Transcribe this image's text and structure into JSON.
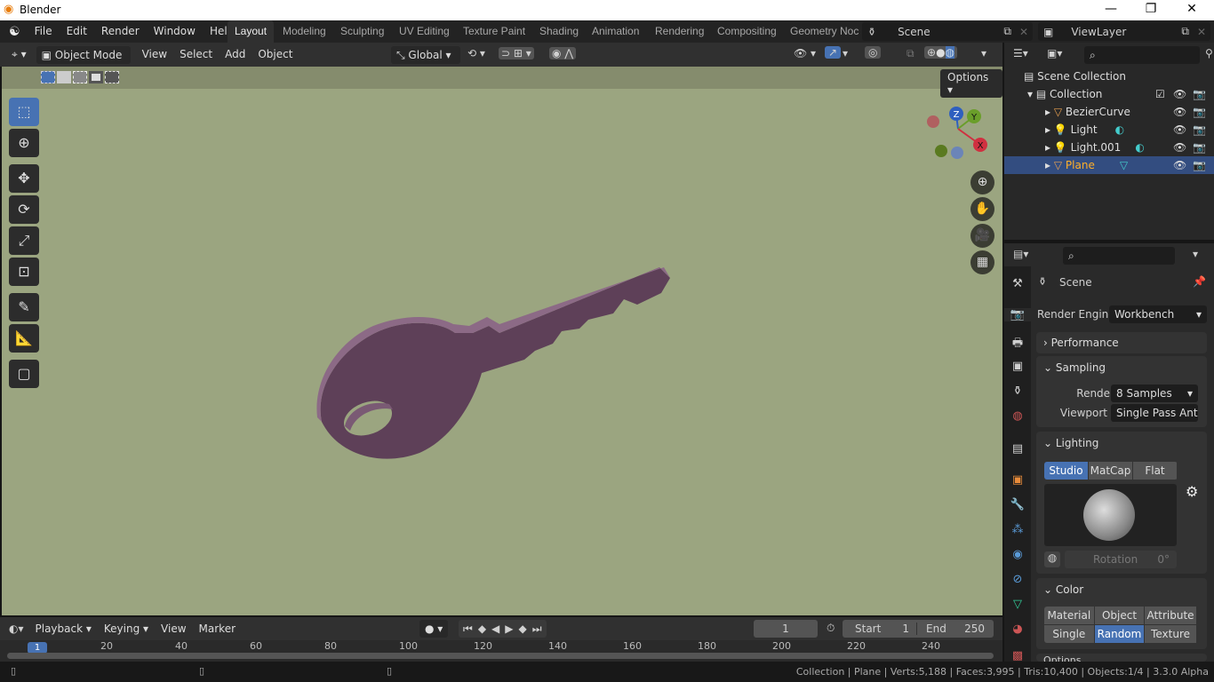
{
  "title": "Blender",
  "menus": [
    "File",
    "Edit",
    "Render",
    "Window",
    "Help"
  ],
  "workspaces": [
    "Layout",
    "Modeling",
    "Sculpting",
    "UV Editing",
    "Texture Paint",
    "Shading",
    "Animation",
    "Rendering",
    "Compositing",
    "Geometry Noc"
  ],
  "scene": "Scene",
  "view_layer": "ViewLayer",
  "viewport_header": {
    "mode": "Object Mode",
    "menus": [
      "View",
      "Select",
      "Add",
      "Object"
    ],
    "orientation": "Global",
    "options": "Options"
  },
  "gizmo": {
    "z": "Z",
    "y": "Y",
    "x": "X"
  },
  "outliner": {
    "root": "Scene Collection",
    "collection": "Collection",
    "items": [
      "BezierCurve",
      "Light",
      "Light.001",
      "Plane"
    ],
    "selected": "Plane"
  },
  "properties": {
    "context": "Scene",
    "render_engine_label": "Render Engine",
    "render_engine": "Workbench",
    "performance": "Performance",
    "sampling": "Sampling",
    "render_label": "Render",
    "render_value": "8 Samples",
    "viewport_label": "Viewport",
    "viewport_value": "Single Pass Ant",
    "lighting": "Lighting",
    "lighting_modes": [
      "Studio",
      "MatCap",
      "Flat"
    ],
    "lighting_active": "Studio",
    "rotation_label": "Rotation",
    "rotation_value": "0°",
    "color": "Color",
    "color_modes": [
      "Material",
      "Object",
      "Attribute",
      "Single",
      "Random",
      "Texture"
    ],
    "color_active": "Random",
    "next_panel": "Options"
  },
  "timeline": {
    "menus": [
      "Playback",
      "Keying",
      "View",
      "Marker"
    ],
    "current_frame": "1",
    "start_label": "Start",
    "start": "1",
    "end_label": "End",
    "end": "250",
    "ticks": [
      "20",
      "40",
      "60",
      "80",
      "100",
      "120",
      "140",
      "160",
      "180",
      "200",
      "220",
      "240"
    ],
    "playhead": "1"
  },
  "status": "Collection | Plane | Verts:5,188 | Faces:3,995 | Tris:10,400 | Objects:1/4 | 3.3.0 Alpha",
  "colors": {
    "accent": "#4772b3",
    "viewport_bg": "#9ba580",
    "key": "#5e4058"
  }
}
